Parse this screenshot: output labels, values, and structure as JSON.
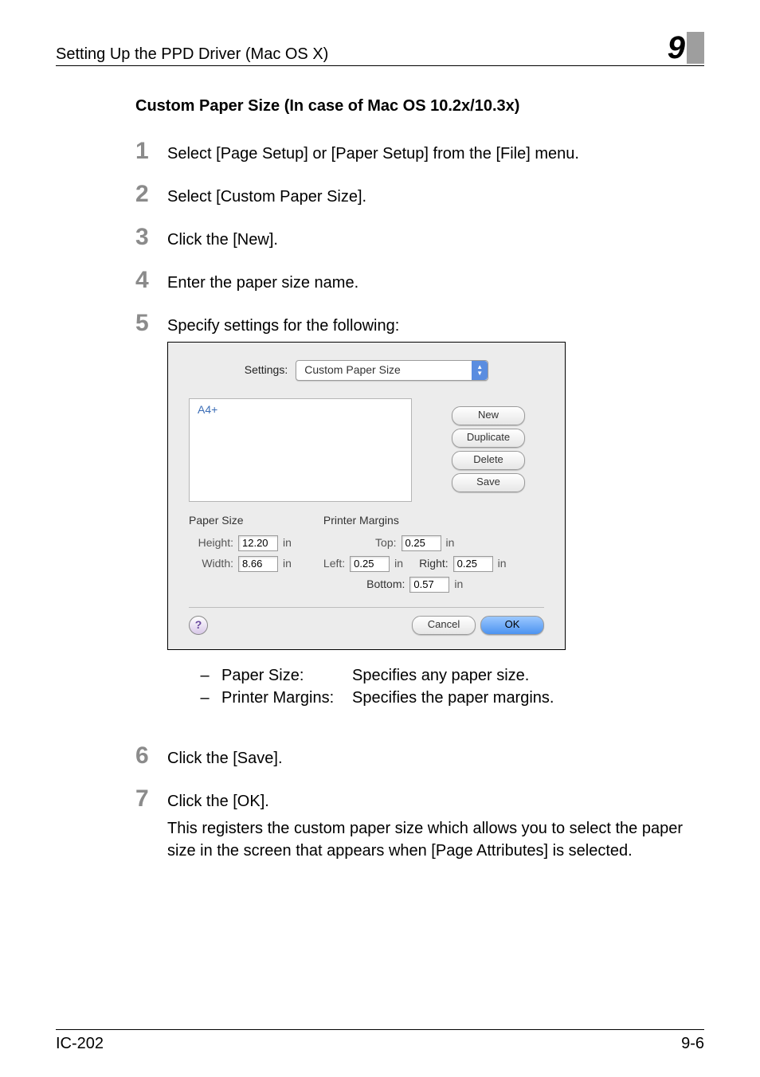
{
  "header": {
    "title": "Setting Up the PPD Driver (Mac OS X)",
    "chapter": "9"
  },
  "heading": "Custom Paper Size (In case of Mac OS 10.2x/10.3x)",
  "steps": {
    "s1": "Select [Page Setup] or [Paper Setup] from the [File] menu.",
    "s2": "Select [Custom Paper Size].",
    "s3": "Click the [New].",
    "s4": "Enter the paper size name.",
    "s5": "Specify settings for the following:",
    "s6": "Click the [Save].",
    "s7": "Click the [OK]."
  },
  "dialog": {
    "settings_label": "Settings:",
    "settings_value": "Custom Paper Size",
    "name_item": "A4+",
    "buttons": {
      "new": "New",
      "duplicate": "Duplicate",
      "delete": "Delete",
      "save": "Save",
      "cancel": "Cancel",
      "ok": "OK"
    },
    "paper_size_title": "Paper Size",
    "margins_title": "Printer Margins",
    "labels": {
      "height": "Height:",
      "width": "Width:",
      "top": "Top:",
      "left": "Left:",
      "right": "Right:",
      "bottom": "Bottom:"
    },
    "values": {
      "height": "12.20",
      "width": "8.66",
      "top": "0.25",
      "left": "0.25",
      "right": "0.25",
      "bottom": "0.57"
    },
    "unit": "in",
    "help": "?"
  },
  "descriptions": {
    "paper_term": "Paper Size:",
    "paper_desc": "Specifies any paper size.",
    "margin_term": "Printer Margins:",
    "margin_desc": "Specifies the paper margins."
  },
  "note": "This registers the custom paper size which allows you to select the paper size in the screen that appears when [Page Attributes] is selected.",
  "footer": {
    "left": "IC-202",
    "right": "9-6"
  }
}
